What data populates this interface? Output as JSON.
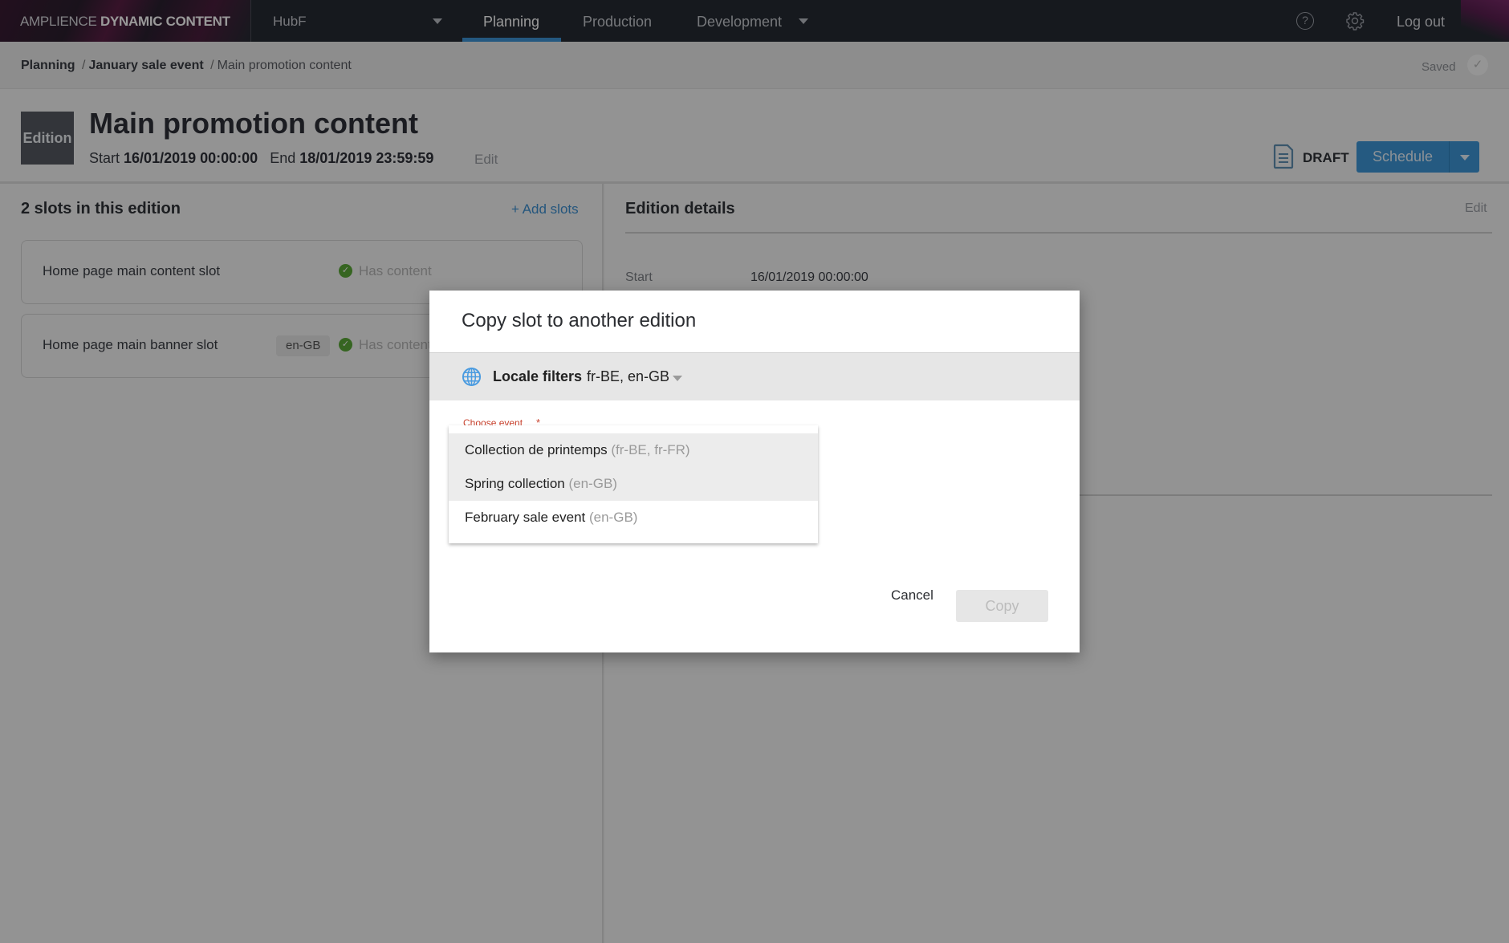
{
  "topnav": {
    "brand_light": "AMPLIENCE",
    "brand_bold": "DYNAMIC CONTENT",
    "hub": "HubF",
    "tabs": [
      {
        "label": "Planning",
        "active": true
      },
      {
        "label": "Production",
        "active": false
      },
      {
        "label": "Development",
        "active": false
      }
    ],
    "help_glyph": "?",
    "logout": "Log out",
    "icons": [
      "help-icon",
      "gear-icon"
    ]
  },
  "breadcrumb": {
    "items": [
      "Planning",
      "January sale event",
      "Main promotion content"
    ],
    "separator": "/",
    "saved": "Saved",
    "saved_glyph": "✓"
  },
  "header": {
    "badge": "Edition",
    "title": "Main promotion content",
    "start_label": "Start",
    "start_value": "16/01/2019 00:00:00",
    "end_label": "End",
    "end_value": "18/01/2019 23:59:59",
    "edit": "Edit",
    "status": "DRAFT",
    "schedule": "Schedule",
    "accent_color": "#3e97d8"
  },
  "slots": {
    "title": "2 slots in this edition",
    "add": "+ Add slots",
    "items": [
      {
        "name": "Home page main content slot",
        "locale": "",
        "status": "Has content"
      },
      {
        "name": "Home page main banner slot",
        "locale": "en-GB",
        "status": "Has content"
      }
    ],
    "check_glyph": "✓",
    "status_color": "#5aa837"
  },
  "details": {
    "title": "Edition details",
    "edit": "Edit",
    "start_label": "Start",
    "start_value": "16/01/2019 00:00:00"
  },
  "modal": {
    "title": "Copy slot to another edition",
    "locale_label": "Locale filters",
    "locale_value": "fr-BE, en-GB",
    "choose_label": "Choose event",
    "required_mark": "*",
    "options": [
      {
        "name": "Collection de printemps",
        "locales": "(fr-BE, fr-FR)",
        "highlighted": true
      },
      {
        "name": "Spring collection",
        "locales": "(en-GB)",
        "highlighted": true
      },
      {
        "name": "February sale event",
        "locales": "(en-GB)",
        "highlighted": false
      }
    ],
    "cancel": "Cancel",
    "copy": "Copy",
    "copy_disabled": true
  }
}
